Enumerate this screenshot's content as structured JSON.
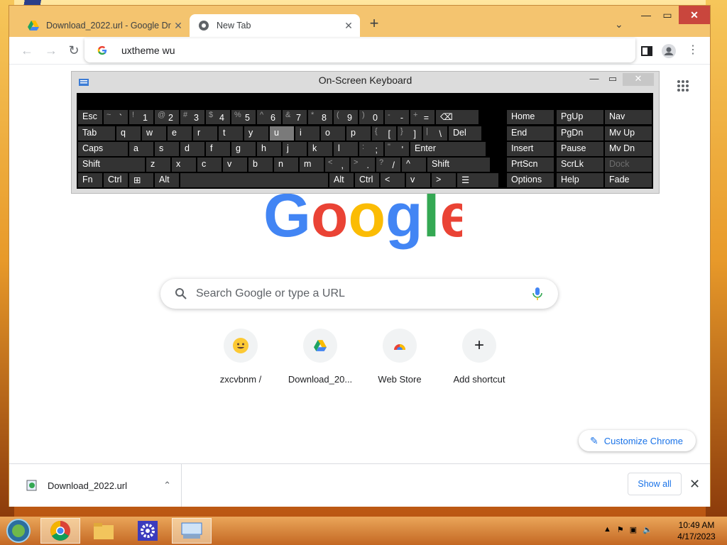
{
  "browser": {
    "tabs": [
      {
        "title": "Download_2022.url - Google Dri",
        "active": false
      },
      {
        "title": "New Tab",
        "active": true
      }
    ],
    "omnibox_text": "uxtheme wu"
  },
  "page": {
    "search_placeholder": "Search Google or type a URL",
    "shortcuts": [
      {
        "label": "zxcvbnm /",
        "icon": "emoji-smile-icon"
      },
      {
        "label": "Download_20...",
        "icon": "google-drive-icon"
      },
      {
        "label": "Web Store",
        "icon": "web-store-icon"
      },
      {
        "label": "Add shortcut",
        "icon": "plus-icon"
      }
    ],
    "customize_label": "Customize Chrome"
  },
  "download_bar": {
    "file_name": "Download_2022.url",
    "show_all_label": "Show all"
  },
  "osk": {
    "title": "On-Screen Keyboard",
    "rows": [
      [
        "Esc",
        "~ `",
        "! 1",
        "@ 2",
        "# 3",
        "$ 4",
        "% 5",
        "^ 6",
        "& 7",
        "* 8",
        "( 9",
        ") 0",
        "- -",
        "+ =",
        "⌫"
      ],
      [
        "Tab",
        "q",
        "w",
        "e",
        "r",
        "t",
        "y",
        "u",
        "i",
        "o",
        "p",
        "{ [",
        "} ]",
        "| \\",
        "Del"
      ],
      [
        "Caps",
        "a",
        "s",
        "d",
        "f",
        "g",
        "h",
        "j",
        "k",
        "l",
        ": ;",
        "\" '",
        "Enter"
      ],
      [
        "Shift",
        "z",
        "x",
        "c",
        "v",
        "b",
        "n",
        "m",
        "< ,",
        "> .",
        "? /",
        "^",
        "Shift"
      ],
      [
        "Fn",
        "Ctrl",
        "⊞",
        "Alt",
        " ",
        "Alt",
        "Ctrl",
        "<",
        "v",
        ">",
        "☰"
      ]
    ],
    "nav_keys": [
      [
        "Home",
        "PgUp",
        "Nav"
      ],
      [
        "End",
        "PgDn",
        "Mv Up"
      ],
      [
        "Insert",
        "Pause",
        "Mv Dn"
      ],
      [
        "PrtScn",
        "ScrLk",
        "Dock"
      ],
      [
        "Options",
        "Help",
        "Fade"
      ]
    ]
  },
  "taskbar": {
    "time": "10:49 AM",
    "date": "4/17/2023"
  }
}
